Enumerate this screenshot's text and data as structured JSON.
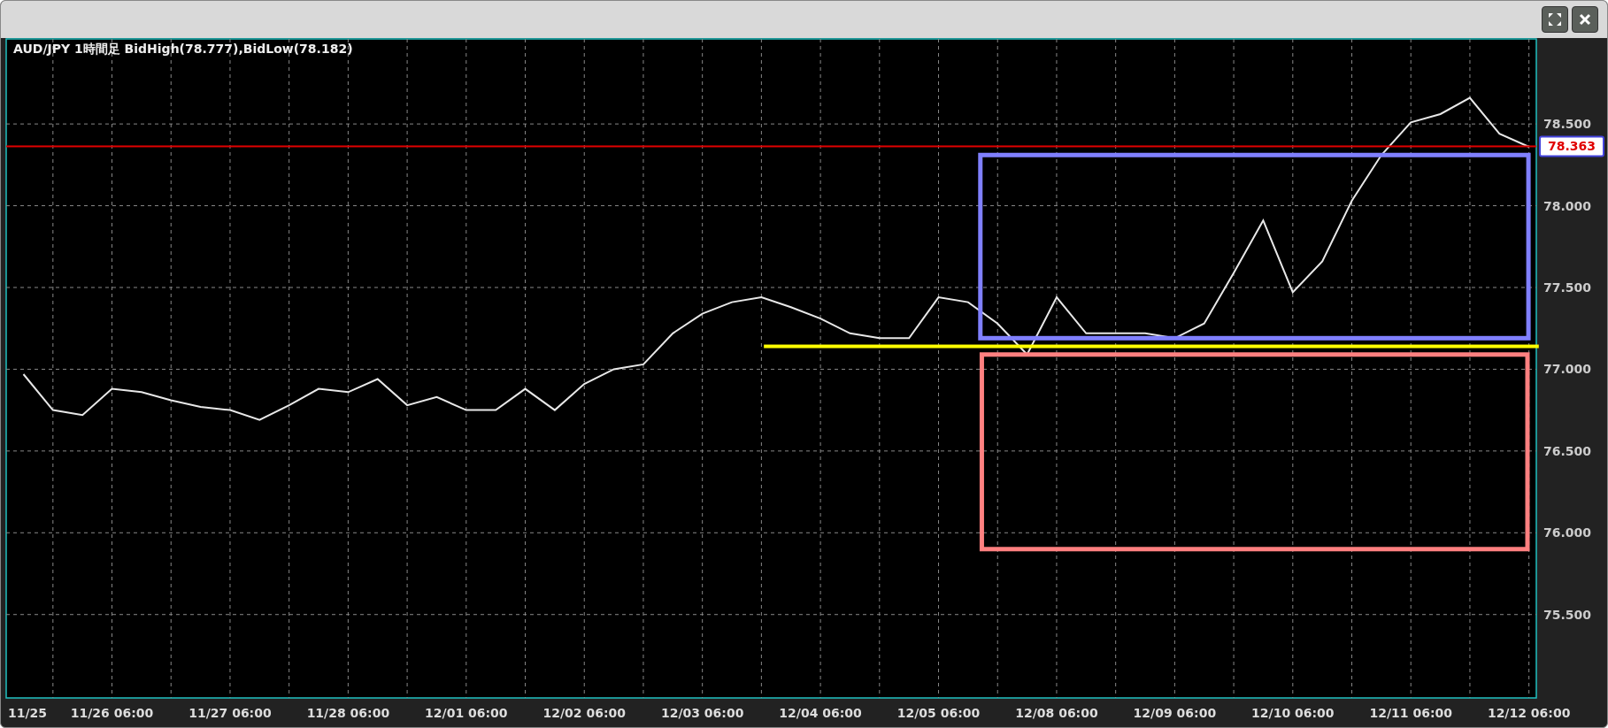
{
  "window": {
    "buttons": [
      {
        "kind": "maximize"
      },
      {
        "kind": "close"
      }
    ]
  },
  "chart": {
    "title": "AUD/JPY 1時間足  BidHigh(78.777),BidLow(78.182)",
    "chart_data": {
      "type": "line",
      "categories": [
        "11/25",
        null,
        null,
        "11/26 06:00",
        null,
        null,
        null,
        "11/27 06:00",
        null,
        null,
        null,
        "11/28 06:00",
        null,
        null,
        null,
        "12/01 06:00",
        null,
        null,
        null,
        "12/02 06:00",
        null,
        null,
        null,
        "12/03 06:00",
        null,
        null,
        null,
        "12/04 06:00",
        null,
        null,
        null,
        "12/05 06:00",
        null,
        null,
        null,
        "12/08 06:00",
        null,
        null,
        null,
        "12/09 06:00",
        null,
        null,
        null,
        "12/10 06:00",
        null,
        null,
        null,
        "12/11 06:00",
        null,
        null,
        null,
        "12/12 06:00"
      ],
      "series": [
        {
          "color": "#e8e8e8",
          "values": [
            76.97,
            76.75,
            76.72,
            76.88,
            76.86,
            76.81,
            76.77,
            76.75,
            76.69,
            76.78,
            76.88,
            76.86,
            76.94,
            76.78,
            76.83,
            76.75,
            76.75,
            76.88,
            76.75,
            76.91,
            77.0,
            77.03,
            77.22,
            77.34,
            77.41,
            77.44,
            77.38,
            77.31,
            77.22,
            77.19,
            77.19,
            77.44,
            77.41,
            77.28,
            77.09,
            77.44,
            77.22,
            77.22,
            77.22,
            77.19,
            77.28,
            77.59,
            77.91,
            77.47,
            77.66,
            78.03,
            78.31,
            78.51,
            78.56,
            78.66,
            78.44,
            78.36
          ]
        }
      ],
      "ylim": [
        74.99,
        79.02
      ],
      "grid": true,
      "yticks": [
        {
          "value": 75.5,
          "label": "75.500"
        },
        {
          "value": 76,
          "label": "76.000"
        },
        {
          "value": 76.5,
          "label": "76.500"
        },
        {
          "value": 77,
          "label": "77.000"
        },
        {
          "value": 77.5,
          "label": "77.500"
        },
        {
          "value": 78,
          "label": "78.000"
        },
        {
          "value": 78.5,
          "label": "78.500"
        }
      ]
    },
    "drawings": [
      {
        "kind": "hline",
        "color": "#e00000",
        "label": "78.363"
      },
      {
        "kind": "rect",
        "color": "#8080ff"
      },
      {
        "kind": "segment",
        "color": "#ffff00"
      },
      {
        "kind": "rect",
        "color": "#ff8080"
      }
    ]
  }
}
